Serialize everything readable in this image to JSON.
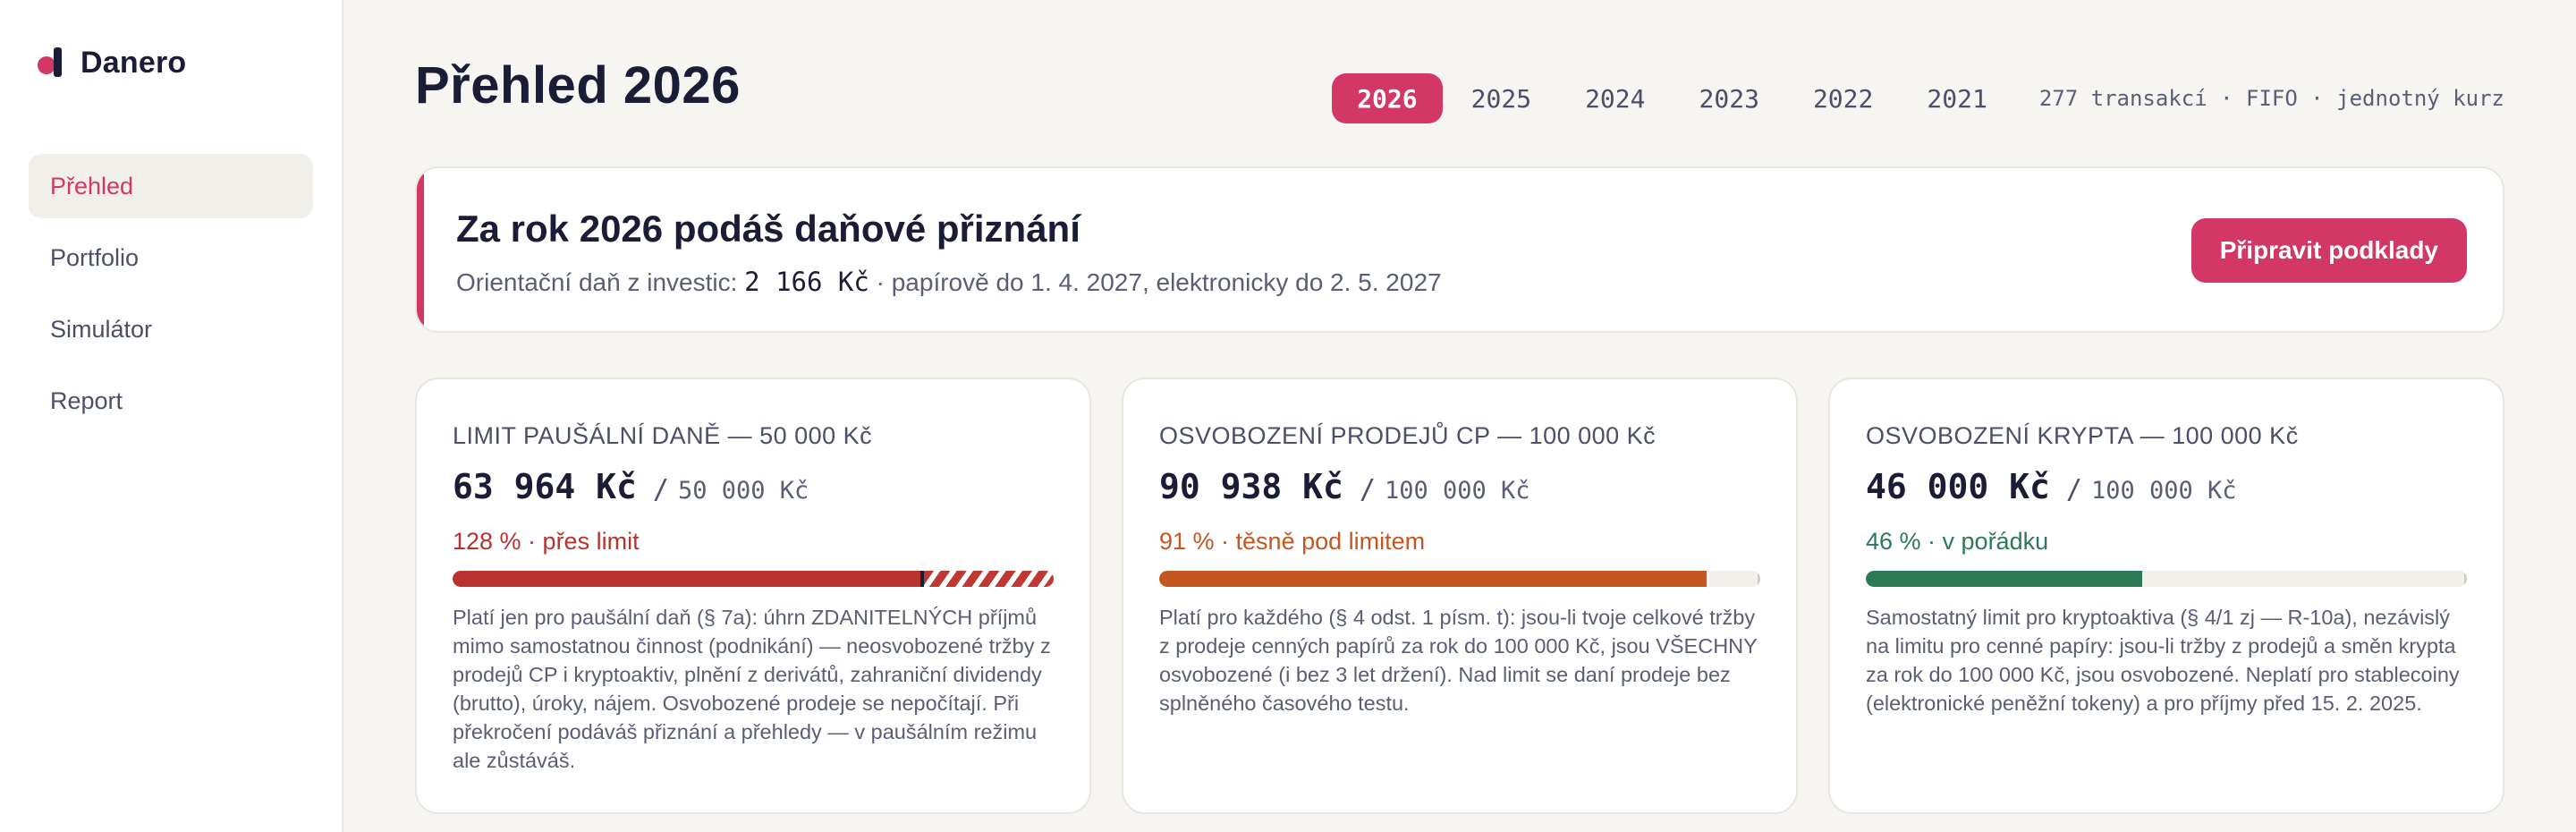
{
  "brand": {
    "name": "Danero"
  },
  "nav": [
    {
      "label": "Přehled",
      "active": true
    },
    {
      "label": "Portfolio"
    },
    {
      "label": "Simulátor"
    },
    {
      "label": "Report"
    }
  ],
  "page": {
    "title": "Přehled 2026"
  },
  "years": [
    "2026",
    "2025",
    "2024",
    "2023",
    "2022",
    "2021"
  ],
  "active_year": "2026",
  "meta": "277 transakcí · FIFO · jednotný kurz",
  "banner": {
    "title": "Za rok 2026 podáš daňové přiznání",
    "sub_prefix": "Orientační daň z investic:",
    "amount": "2 166 Kč",
    "sub_suffix": "· papírově do 1. 4. 2027, elektronicky do 2. 5. 2027",
    "cta_label": "Připravit podklady"
  },
  "cards": [
    {
      "label": "LIMIT PAUŠÁLNÍ DANĚ — 50 000 Kč",
      "value": "63 964 Kč",
      "slash": "/",
      "limit": "50 000 Kč",
      "status": "128 % · přes limit",
      "progress": 1.28,
      "status_color": "#b8322e",
      "description": "Platí jen pro paušální daň (§ 7a): úhrn ZDANITELNÝCH příjmů mimo samostatnou činnost (podnikání) — neosvobozené tržby z prodejů CP i kryptoaktiv, plnění z derivátů, zahraniční dividendy (brutto), úroky, nájem. Osvobozené prodeje se nepočítají. Při překročení podáváš přiznání a přehledy — v paušálním režimu ale zůstáváš."
    },
    {
      "label": "OSVOBOZENÍ PRODEJŮ CP — 100 000 Kč",
      "value": "90 938 Kč",
      "slash": "/",
      "limit": "100 000 Kč",
      "status": "91 % · těsně pod limitem",
      "progress": 0.91,
      "status_color": "#c6561f",
      "description": "Platí pro každého (§ 4 odst. 1 písm. t): jsou-li tvoje celkové tržby z prodeje cenných papírů za rok do 100 000 Kč, jsou VŠECHNY osvobozené (i bez 3 let držení). Nad limit se daní prodeje bez splněného časového testu."
    },
    {
      "label": "OSVOBOZENÍ KRYPTA — 100 000 Kč",
      "value": "46 000 Kč",
      "slash": "/",
      "limit": "100 000 Kč",
      "status": "46 % · v pořádku",
      "progress": 0.46,
      "status_color": "#2c7a55",
      "description": "Samostatný limit pro kryptoaktiva (§ 4/1 zj — R-10a), nezávislý na limitu pro cenné papíry: jsou-li tržby z prodejů a směn krypta za rok do 100 000 Kč, jsou osvobozené. Neplatí pro stablecoiny (elektronické peněžní tokeny) a pro příjmy před 15. 2. 2025."
    }
  ]
}
